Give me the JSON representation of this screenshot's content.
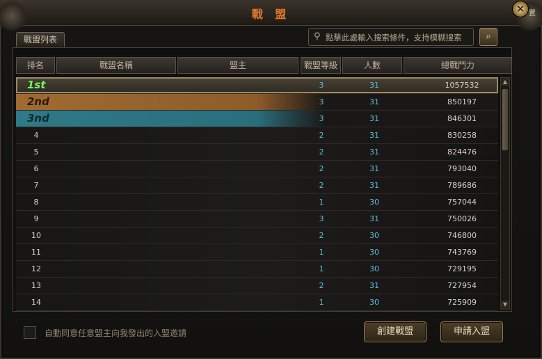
{
  "window": {
    "title": "戰 盟",
    "close_label": "✕",
    "close_extra": "置"
  },
  "tabs": [
    {
      "label": "戰盟列表"
    }
  ],
  "search": {
    "placeholder": "點擊此處輸入搜索條件，支持模糊搜索",
    "button_icon": "search-icon"
  },
  "table": {
    "headers": [
      "排名",
      "戰盟名稱",
      "盟主",
      "戰盟等級",
      "人數",
      "總戰鬥力"
    ],
    "rows": [
      {
        "rank": "1st",
        "name": "",
        "leader": "",
        "level": "3",
        "members": "31",
        "power": "1057532"
      },
      {
        "rank": "2nd",
        "name": "",
        "leader": "",
        "level": "3",
        "members": "31",
        "power": "850197"
      },
      {
        "rank": "3nd",
        "name": "",
        "leader": "",
        "level": "3",
        "members": "31",
        "power": "846301"
      },
      {
        "rank": "4",
        "name": "",
        "leader": "",
        "level": "2",
        "members": "31",
        "power": "830258"
      },
      {
        "rank": "5",
        "name": "",
        "leader": "",
        "level": "2",
        "members": "31",
        "power": "824476"
      },
      {
        "rank": "6",
        "name": "",
        "leader": "",
        "level": "2",
        "members": "31",
        "power": "793040"
      },
      {
        "rank": "7",
        "name": "",
        "leader": "",
        "level": "2",
        "members": "31",
        "power": "789686"
      },
      {
        "rank": "8",
        "name": "",
        "leader": "",
        "level": "1",
        "members": "30",
        "power": "757044"
      },
      {
        "rank": "9",
        "name": "",
        "leader": "",
        "level": "3",
        "members": "31",
        "power": "750026"
      },
      {
        "rank": "10",
        "name": "",
        "leader": "",
        "level": "2",
        "members": "30",
        "power": "746800"
      },
      {
        "rank": "11",
        "name": "",
        "leader": "",
        "level": "1",
        "members": "30",
        "power": "743769"
      },
      {
        "rank": "12",
        "name": "",
        "leader": "",
        "level": "1",
        "members": "30",
        "power": "729195"
      },
      {
        "rank": "13",
        "name": "",
        "leader": "",
        "level": "2",
        "members": "31",
        "power": "727954"
      },
      {
        "rank": "14",
        "name": "",
        "leader": "",
        "level": "1",
        "members": "30",
        "power": "725909"
      }
    ]
  },
  "footer": {
    "auto_accept_label": "自動同意任意盟主向我發出的入盟邀請",
    "create_button": "創建戰盟",
    "apply_button": "申請入盟"
  },
  "colors": {
    "title": "#e07a2a",
    "rank1": "#7ff06a",
    "rank2_row": "#a06a32",
    "rank3_row": "#2f7a88",
    "stat_value": "#5fb8d8"
  }
}
